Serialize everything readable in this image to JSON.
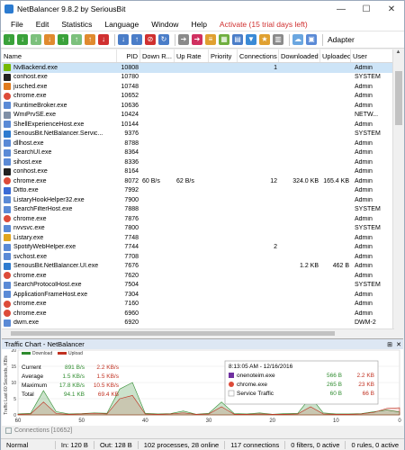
{
  "window": {
    "title": "NetBalancer 9.8.2 by SeriousBit",
    "minimize": "—",
    "maximize": "☐",
    "close": "✕"
  },
  "menu": [
    "File",
    "Edit",
    "Statistics",
    "Language",
    "Window",
    "Help"
  ],
  "activate_label": "Activate (15 trial days left)",
  "toolbar": {
    "adapter_label": "Adapter"
  },
  "columns": [
    "Name",
    "PID",
    "Down R...",
    "Up Rate",
    "Priority",
    "Connections",
    "Downloaded",
    "Uploaded",
    "User"
  ],
  "processes": [
    {
      "name": "NvBackend.exe",
      "pid": "10808",
      "down": "",
      "up": "",
      "prio": "",
      "conn": "1",
      "dl": "",
      "ul": "",
      "user": "Admin",
      "color": "#76b900",
      "selected": true
    },
    {
      "name": "conhost.exe",
      "pid": "10780",
      "down": "",
      "up": "",
      "prio": "",
      "conn": "",
      "dl": "",
      "ul": "",
      "user": "SYSTEM",
      "color": "#222222"
    },
    {
      "name": "jusched.exe",
      "pid": "10748",
      "down": "",
      "up": "",
      "prio": "",
      "conn": "",
      "dl": "",
      "ul": "",
      "user": "Admin",
      "color": "#e07b1e"
    },
    {
      "name": "chrome.exe",
      "pid": "10652",
      "down": "",
      "up": "",
      "prio": "",
      "conn": "",
      "dl": "",
      "ul": "",
      "user": "Admin",
      "color": "#dd4b39"
    },
    {
      "name": "RuntimeBroker.exe",
      "pid": "10636",
      "down": "",
      "up": "",
      "prio": "",
      "conn": "",
      "dl": "",
      "ul": "",
      "user": "Admin",
      "color": "#5a8ad6"
    },
    {
      "name": "WmiPrvSE.exe",
      "pid": "10424",
      "down": "",
      "up": "",
      "prio": "",
      "conn": "",
      "dl": "",
      "ul": "",
      "user": "NETW...",
      "color": "#7f8fa6"
    },
    {
      "name": "ShellExperienceHost.exe",
      "pid": "10144",
      "down": "",
      "up": "",
      "prio": "",
      "conn": "",
      "dl": "",
      "ul": "",
      "user": "Admin",
      "color": "#5a8ad6"
    },
    {
      "name": "SeriousBit.NetBalancer.Servic...",
      "pid": "9376",
      "down": "",
      "up": "",
      "prio": "",
      "conn": "",
      "dl": "",
      "ul": "",
      "user": "SYSTEM",
      "color": "#2e7bcf"
    },
    {
      "name": "dllhost.exe",
      "pid": "8788",
      "down": "",
      "up": "",
      "prio": "",
      "conn": "",
      "dl": "",
      "ul": "",
      "user": "Admin",
      "color": "#5a8ad6"
    },
    {
      "name": "SearchUI.exe",
      "pid": "8364",
      "down": "",
      "up": "",
      "prio": "",
      "conn": "",
      "dl": "",
      "ul": "",
      "user": "Admin",
      "color": "#5a8ad6"
    },
    {
      "name": "sihost.exe",
      "pid": "8336",
      "down": "",
      "up": "",
      "prio": "",
      "conn": "",
      "dl": "",
      "ul": "",
      "user": "Admin",
      "color": "#5a8ad6"
    },
    {
      "name": "conhost.exe",
      "pid": "8164",
      "down": "",
      "up": "",
      "prio": "",
      "conn": "",
      "dl": "",
      "ul": "",
      "user": "Admin",
      "color": "#222222"
    },
    {
      "name": "chrome.exe",
      "pid": "8072",
      "down": "60 B/s",
      "up": "62 B/s",
      "prio": "",
      "conn": "12",
      "dl": "324.0 KB",
      "ul": "165.4 KB",
      "user": "Admin",
      "color": "#dd4b39"
    },
    {
      "name": "Ditto.exe",
      "pid": "7992",
      "down": "",
      "up": "",
      "prio": "",
      "conn": "",
      "dl": "",
      "ul": "",
      "user": "Admin",
      "color": "#3a6bd6"
    },
    {
      "name": "ListaryHookHelper32.exe",
      "pid": "7900",
      "down": "",
      "up": "",
      "prio": "",
      "conn": "",
      "dl": "",
      "ul": "",
      "user": "Admin",
      "color": "#5a8ad6"
    },
    {
      "name": "SearchFilterHost.exe",
      "pid": "7888",
      "down": "",
      "up": "",
      "prio": "",
      "conn": "",
      "dl": "",
      "ul": "",
      "user": "SYSTEM",
      "color": "#5a8ad6"
    },
    {
      "name": "chrome.exe",
      "pid": "7876",
      "down": "",
      "up": "",
      "prio": "",
      "conn": "",
      "dl": "",
      "ul": "",
      "user": "Admin",
      "color": "#dd4b39"
    },
    {
      "name": "nvvsvc.exe",
      "pid": "7800",
      "down": "",
      "up": "",
      "prio": "",
      "conn": "",
      "dl": "",
      "ul": "",
      "user": "SYSTEM",
      "color": "#5a8ad6"
    },
    {
      "name": "Listary.exe",
      "pid": "7748",
      "down": "",
      "up": "",
      "prio": "",
      "conn": "",
      "dl": "",
      "ul": "",
      "user": "Admin",
      "color": "#e0a51e"
    },
    {
      "name": "SpotifyWebHelper.exe",
      "pid": "7744",
      "down": "",
      "up": "",
      "prio": "",
      "conn": "2",
      "dl": "",
      "ul": "",
      "user": "Admin",
      "color": "#5a8ad6"
    },
    {
      "name": "svchost.exe",
      "pid": "7708",
      "down": "",
      "up": "",
      "prio": "",
      "conn": "",
      "dl": "",
      "ul": "",
      "user": "Admin",
      "color": "#5a8ad6"
    },
    {
      "name": "SeriousBit.NetBalancer.UI.exe",
      "pid": "7676",
      "down": "",
      "up": "",
      "prio": "",
      "conn": "",
      "dl": "1.2 KB",
      "ul": "462 B",
      "user": "Admin",
      "color": "#2e7bcf"
    },
    {
      "name": "chrome.exe",
      "pid": "7620",
      "down": "",
      "up": "",
      "prio": "",
      "conn": "",
      "dl": "",
      "ul": "",
      "user": "Admin",
      "color": "#dd4b39"
    },
    {
      "name": "SearchProtocolHost.exe",
      "pid": "7504",
      "down": "",
      "up": "",
      "prio": "",
      "conn": "",
      "dl": "",
      "ul": "",
      "user": "SYSTEM",
      "color": "#5a8ad6"
    },
    {
      "name": "ApplicationFrameHost.exe",
      "pid": "7304",
      "down": "",
      "up": "",
      "prio": "",
      "conn": "",
      "dl": "",
      "ul": "",
      "user": "Admin",
      "color": "#5a8ad6"
    },
    {
      "name": "chrome.exe",
      "pid": "7160",
      "down": "",
      "up": "",
      "prio": "",
      "conn": "",
      "dl": "",
      "ul": "",
      "user": "Admin",
      "color": "#dd4b39"
    },
    {
      "name": "chrome.exe",
      "pid": "6960",
      "down": "",
      "up": "",
      "prio": "",
      "conn": "",
      "dl": "",
      "ul": "",
      "user": "Admin",
      "color": "#dd4b39"
    },
    {
      "name": "dwm.exe",
      "pid": "6920",
      "down": "",
      "up": "",
      "prio": "",
      "conn": "",
      "dl": "",
      "ul": "",
      "user": "DWM-2",
      "color": "#5a8ad6"
    }
  ],
  "chart_panel": {
    "title": "Traffic Chart - NetBalancer",
    "pin": "⊞",
    "close": "✕",
    "legend_download": "Download",
    "legend_upload": "Upload",
    "y_axis_label": "Traffic Last 60 Seconds, KB/s",
    "stats": [
      {
        "label": "Current",
        "down": "891 B/s",
        "up": "2.2 KB/s"
      },
      {
        "label": "Average",
        "down": "1.5 KB/s",
        "up": "1.5 KB/s"
      },
      {
        "label": "Maximum",
        "down": "17.8 KB/s",
        "up": "10.5 KB/s"
      },
      {
        "label": "Total",
        "down": "94.1 KB",
        "up": "69.4 KB"
      }
    ],
    "tooltip": {
      "time": "8:13:05 AM - 12/16/2016",
      "rows": [
        {
          "name": "onenoteim.exe",
          "down": "566 B",
          "up": "2.2 KB",
          "color": "#7030a0"
        },
        {
          "name": "chrome.exe",
          "down": "265 B",
          "up": "23 KB",
          "color": "#dd4b39"
        },
        {
          "name": "Service Traffic",
          "down": "60 B",
          "up": "66 B",
          "color": ""
        }
      ]
    },
    "chart_data": {
      "type": "area",
      "x": [
        60,
        58,
        56,
        54,
        52,
        50,
        48,
        46,
        44,
        42,
        40,
        38,
        36,
        34,
        32,
        30,
        28,
        26,
        24,
        22,
        20,
        18,
        16,
        14,
        12,
        10,
        8,
        6,
        4,
        2,
        0
      ],
      "x_ticks": [
        "60",
        "50",
        "40",
        "30",
        "20",
        "10",
        "0"
      ],
      "xlim": [
        60,
        0
      ],
      "y_ticks": [
        "0",
        "5",
        "10",
        "15",
        "20"
      ],
      "ylim": [
        0,
        20
      ],
      "series": [
        {
          "name": "Download",
          "color": "#2e8b2e",
          "values": [
            0.3,
            0.5,
            7.5,
            1.0,
            0.3,
            0.4,
            0.6,
            0.5,
            8.0,
            10.0,
            0.5,
            0.3,
            0.4,
            1.2,
            0.2,
            0.5,
            4.0,
            0.4,
            0.3,
            0.6,
            0.2,
            0.4,
            0.5,
            5.5,
            0.6,
            0.3,
            0.3,
            0.4,
            1.0,
            1.5,
            0.9
          ]
        },
        {
          "name": "Upload",
          "color": "#c03020",
          "values": [
            0.2,
            0.3,
            4.0,
            0.4,
            0.2,
            0.3,
            0.5,
            0.3,
            5.0,
            6.0,
            0.3,
            0.2,
            0.3,
            0.6,
            0.2,
            0.3,
            2.5,
            0.2,
            0.2,
            0.3,
            0.2,
            0.2,
            0.3,
            2.5,
            0.3,
            0.2,
            0.2,
            0.3,
            0.8,
            2.0,
            2.2
          ]
        }
      ]
    }
  },
  "connections_tab": "Connections [10652]",
  "status": {
    "mode": "Normal",
    "in": "In: 120 B",
    "out": "Out: 128 B",
    "processes": "102 processes, 28 online",
    "connections": "117 connections",
    "filters": "0 filters, 0 active",
    "rules": "0 rules, 0 active"
  }
}
